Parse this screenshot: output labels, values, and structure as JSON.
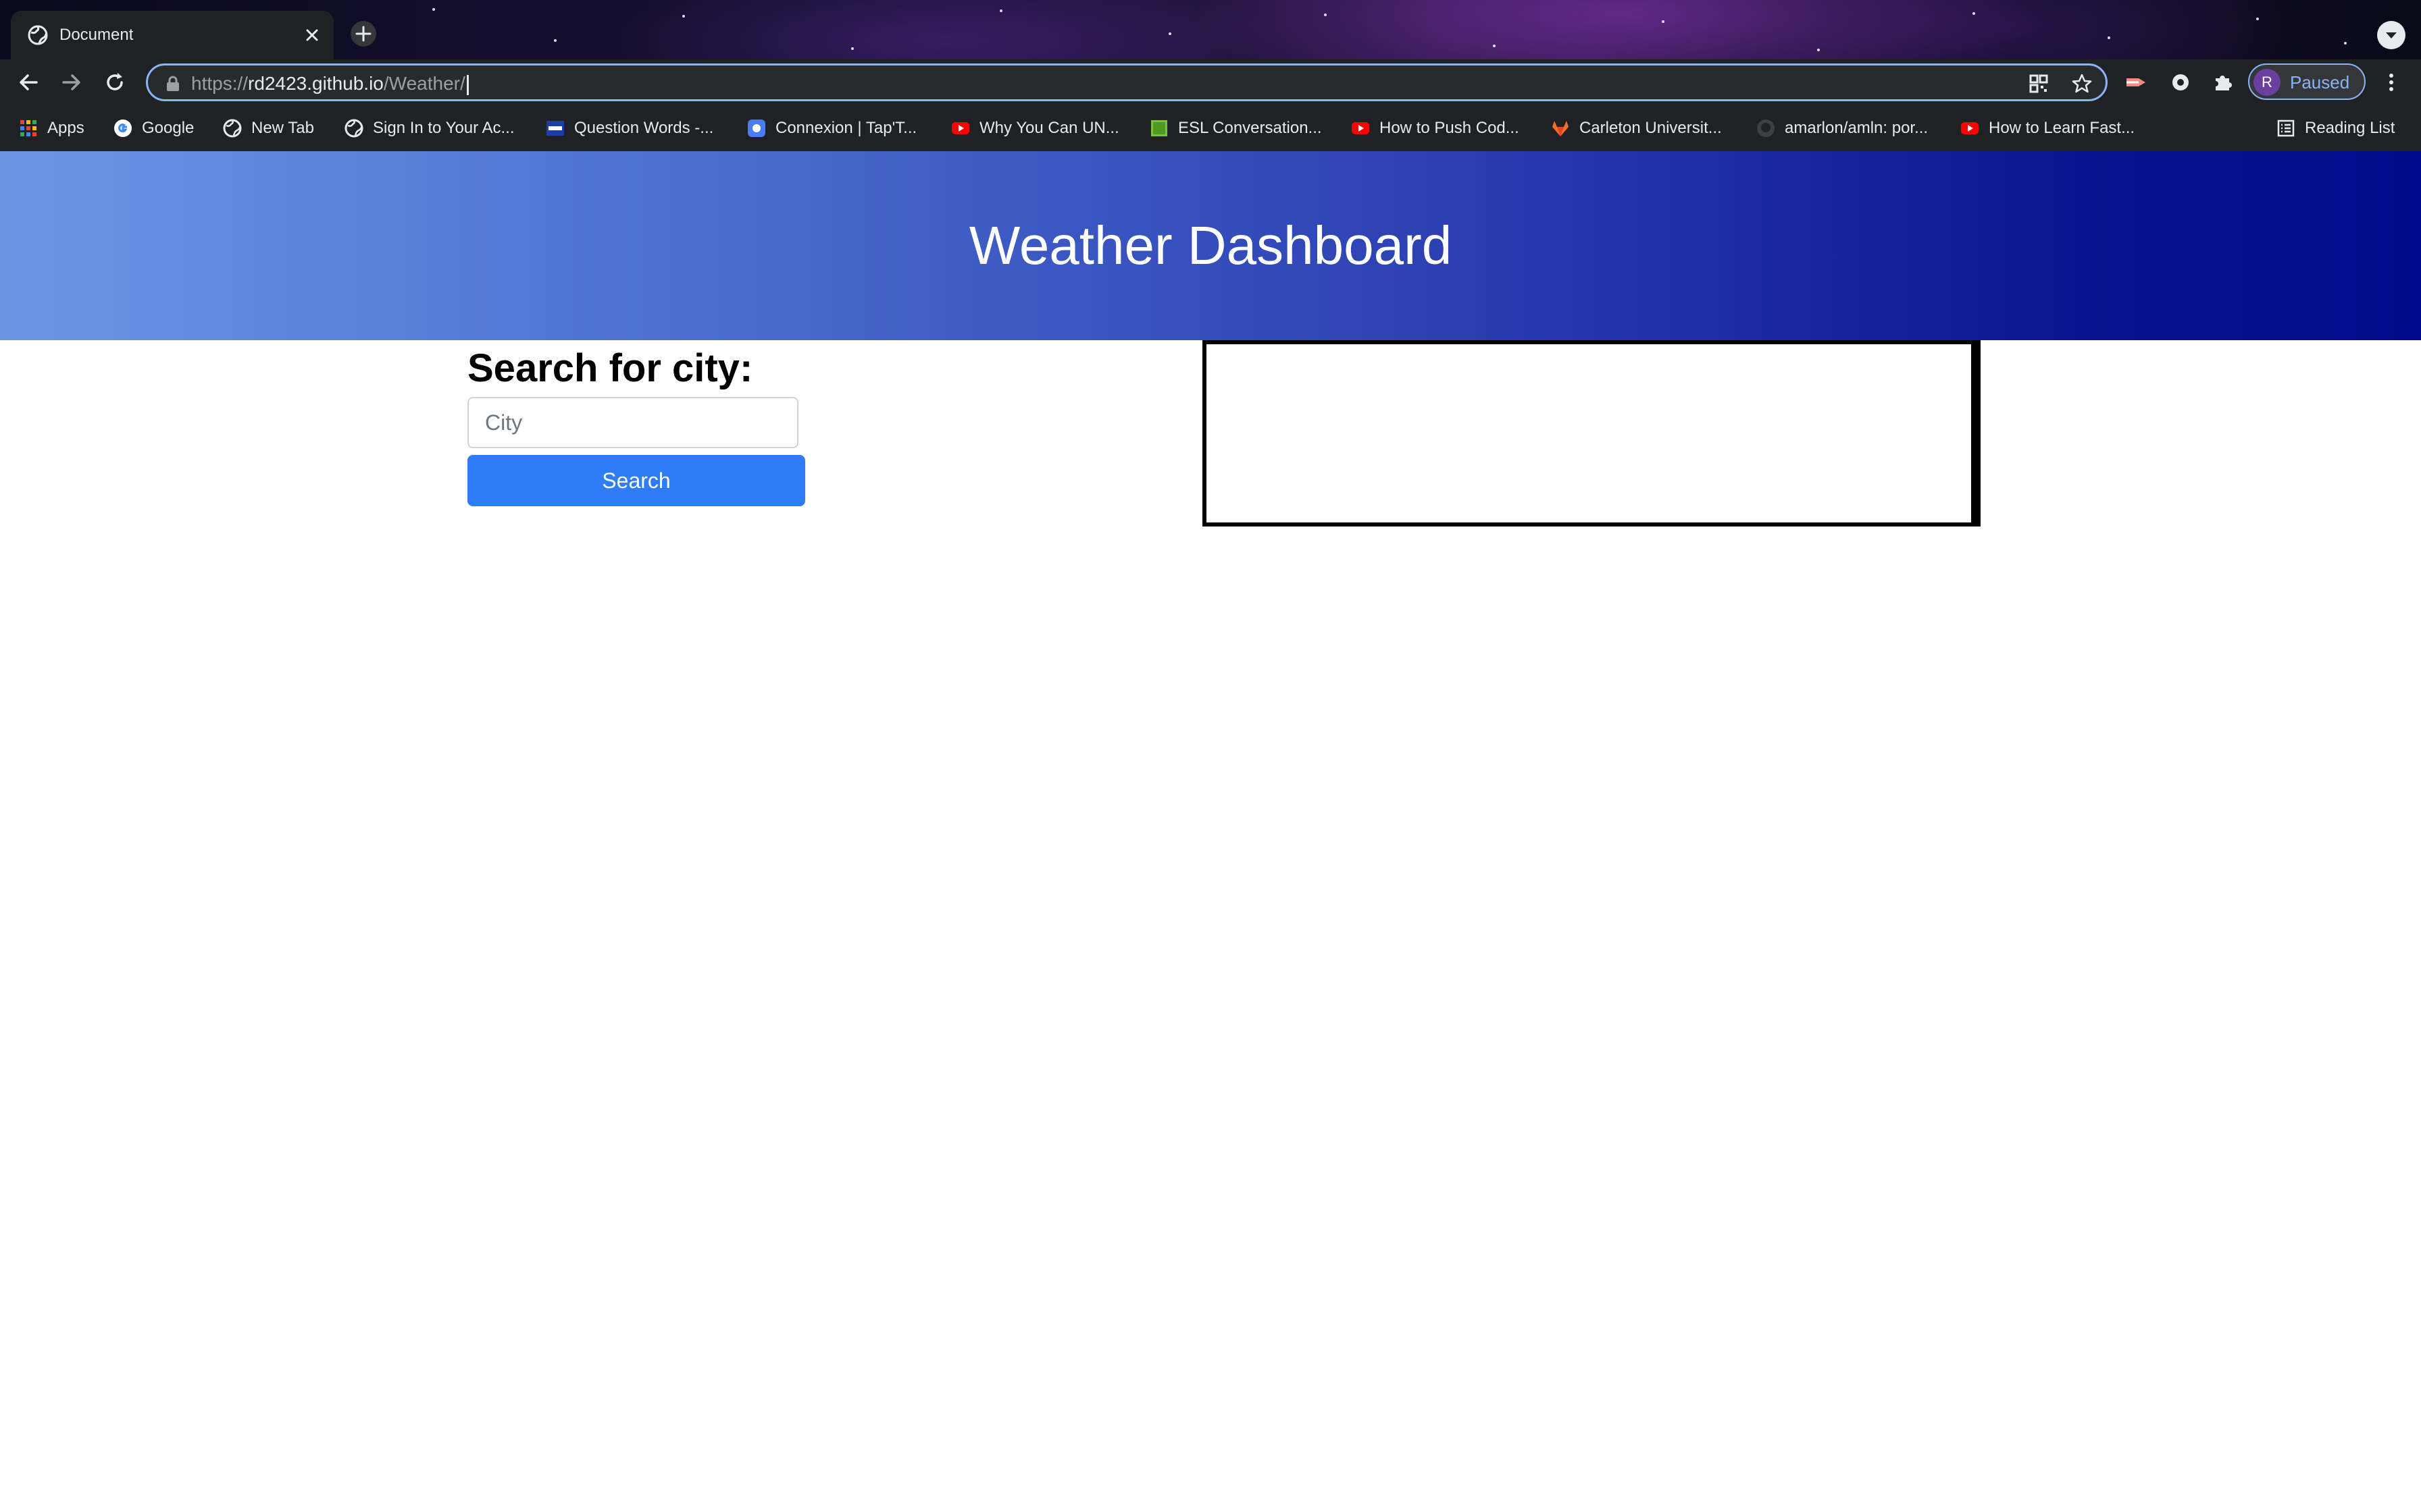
{
  "browser": {
    "tab": {
      "title": "Document"
    },
    "address_bar": {
      "scheme": "https://",
      "host": "rd2423.github.io",
      "path": "/Weather/"
    },
    "profile": {
      "initial": "R",
      "status": "Paused"
    },
    "bookmarks": [
      {
        "label": "Apps",
        "icon": "apps-grid-icon"
      },
      {
        "label": "Google",
        "icon": "google-icon"
      },
      {
        "label": "New Tab",
        "icon": "globe-icon"
      },
      {
        "label": "Sign In to Your Ac...",
        "icon": "globe-icon"
      },
      {
        "label": "Question Words -...",
        "icon": "esl-icon"
      },
      {
        "label": "Connexion | Tap'T...",
        "icon": "tap-icon"
      },
      {
        "label": "Why You Can UN...",
        "icon": "youtube-icon"
      },
      {
        "label": "ESL Conversation...",
        "icon": "green-square-icon"
      },
      {
        "label": "How to Push Cod...",
        "icon": "youtube-icon"
      },
      {
        "label": "Carleton Universit...",
        "icon": "gitlab-icon"
      },
      {
        "label": "amarlon/amln: por...",
        "icon": "github-icon"
      },
      {
        "label": "How to Learn Fast...",
        "icon": "youtube-icon"
      }
    ],
    "reading_list": "Reading List"
  },
  "page": {
    "header_title": "Weather Dashboard",
    "search": {
      "heading": "Search for city:",
      "placeholder": "City",
      "value": "",
      "button_label": "Search"
    }
  },
  "colors": {
    "header_gradient_start": "#6c96e4",
    "header_gradient_end": "#000a8a",
    "search_button": "#2f7df6",
    "omnibox_focus": "#8ab4f8"
  }
}
